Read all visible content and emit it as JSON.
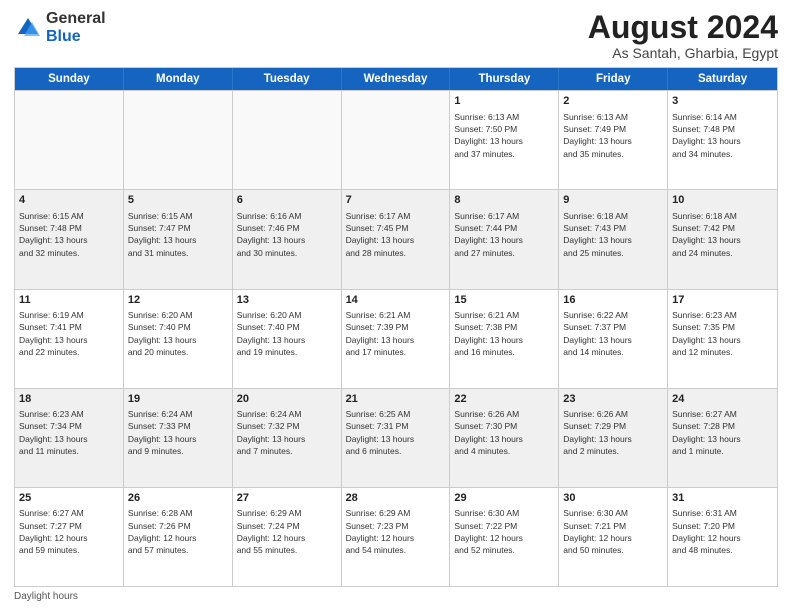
{
  "header": {
    "logo_line1": "General",
    "logo_line2": "Blue",
    "title": "August 2024",
    "subtitle": "As Santah, Gharbia, Egypt"
  },
  "calendar": {
    "weekdays": [
      "Sunday",
      "Monday",
      "Tuesday",
      "Wednesday",
      "Thursday",
      "Friday",
      "Saturday"
    ],
    "weeks": [
      [
        {
          "day": "",
          "info": "",
          "empty": true
        },
        {
          "day": "",
          "info": "",
          "empty": true
        },
        {
          "day": "",
          "info": "",
          "empty": true
        },
        {
          "day": "",
          "info": "",
          "empty": true
        },
        {
          "day": "1",
          "info": "Sunrise: 6:13 AM\nSunset: 7:50 PM\nDaylight: 13 hours\nand 37 minutes.",
          "empty": false
        },
        {
          "day": "2",
          "info": "Sunrise: 6:13 AM\nSunset: 7:49 PM\nDaylight: 13 hours\nand 35 minutes.",
          "empty": false
        },
        {
          "day": "3",
          "info": "Sunrise: 6:14 AM\nSunset: 7:48 PM\nDaylight: 13 hours\nand 34 minutes.",
          "empty": false
        }
      ],
      [
        {
          "day": "4",
          "info": "Sunrise: 6:15 AM\nSunset: 7:48 PM\nDaylight: 13 hours\nand 32 minutes.",
          "empty": false
        },
        {
          "day": "5",
          "info": "Sunrise: 6:15 AM\nSunset: 7:47 PM\nDaylight: 13 hours\nand 31 minutes.",
          "empty": false
        },
        {
          "day": "6",
          "info": "Sunrise: 6:16 AM\nSunset: 7:46 PM\nDaylight: 13 hours\nand 30 minutes.",
          "empty": false
        },
        {
          "day": "7",
          "info": "Sunrise: 6:17 AM\nSunset: 7:45 PM\nDaylight: 13 hours\nand 28 minutes.",
          "empty": false
        },
        {
          "day": "8",
          "info": "Sunrise: 6:17 AM\nSunset: 7:44 PM\nDaylight: 13 hours\nand 27 minutes.",
          "empty": false
        },
        {
          "day": "9",
          "info": "Sunrise: 6:18 AM\nSunset: 7:43 PM\nDaylight: 13 hours\nand 25 minutes.",
          "empty": false
        },
        {
          "day": "10",
          "info": "Sunrise: 6:18 AM\nSunset: 7:42 PM\nDaylight: 13 hours\nand 24 minutes.",
          "empty": false
        }
      ],
      [
        {
          "day": "11",
          "info": "Sunrise: 6:19 AM\nSunset: 7:41 PM\nDaylight: 13 hours\nand 22 minutes.",
          "empty": false
        },
        {
          "day": "12",
          "info": "Sunrise: 6:20 AM\nSunset: 7:40 PM\nDaylight: 13 hours\nand 20 minutes.",
          "empty": false
        },
        {
          "day": "13",
          "info": "Sunrise: 6:20 AM\nSunset: 7:40 PM\nDaylight: 13 hours\nand 19 minutes.",
          "empty": false
        },
        {
          "day": "14",
          "info": "Sunrise: 6:21 AM\nSunset: 7:39 PM\nDaylight: 13 hours\nand 17 minutes.",
          "empty": false
        },
        {
          "day": "15",
          "info": "Sunrise: 6:21 AM\nSunset: 7:38 PM\nDaylight: 13 hours\nand 16 minutes.",
          "empty": false
        },
        {
          "day": "16",
          "info": "Sunrise: 6:22 AM\nSunset: 7:37 PM\nDaylight: 13 hours\nand 14 minutes.",
          "empty": false
        },
        {
          "day": "17",
          "info": "Sunrise: 6:23 AM\nSunset: 7:35 PM\nDaylight: 13 hours\nand 12 minutes.",
          "empty": false
        }
      ],
      [
        {
          "day": "18",
          "info": "Sunrise: 6:23 AM\nSunset: 7:34 PM\nDaylight: 13 hours\nand 11 minutes.",
          "empty": false
        },
        {
          "day": "19",
          "info": "Sunrise: 6:24 AM\nSunset: 7:33 PM\nDaylight: 13 hours\nand 9 minutes.",
          "empty": false
        },
        {
          "day": "20",
          "info": "Sunrise: 6:24 AM\nSunset: 7:32 PM\nDaylight: 13 hours\nand 7 minutes.",
          "empty": false
        },
        {
          "day": "21",
          "info": "Sunrise: 6:25 AM\nSunset: 7:31 PM\nDaylight: 13 hours\nand 6 minutes.",
          "empty": false
        },
        {
          "day": "22",
          "info": "Sunrise: 6:26 AM\nSunset: 7:30 PM\nDaylight: 13 hours\nand 4 minutes.",
          "empty": false
        },
        {
          "day": "23",
          "info": "Sunrise: 6:26 AM\nSunset: 7:29 PM\nDaylight: 13 hours\nand 2 minutes.",
          "empty": false
        },
        {
          "day": "24",
          "info": "Sunrise: 6:27 AM\nSunset: 7:28 PM\nDaylight: 13 hours\nand 1 minute.",
          "empty": false
        }
      ],
      [
        {
          "day": "25",
          "info": "Sunrise: 6:27 AM\nSunset: 7:27 PM\nDaylight: 12 hours\nand 59 minutes.",
          "empty": false
        },
        {
          "day": "26",
          "info": "Sunrise: 6:28 AM\nSunset: 7:26 PM\nDaylight: 12 hours\nand 57 minutes.",
          "empty": false
        },
        {
          "day": "27",
          "info": "Sunrise: 6:29 AM\nSunset: 7:24 PM\nDaylight: 12 hours\nand 55 minutes.",
          "empty": false
        },
        {
          "day": "28",
          "info": "Sunrise: 6:29 AM\nSunset: 7:23 PM\nDaylight: 12 hours\nand 54 minutes.",
          "empty": false
        },
        {
          "day": "29",
          "info": "Sunrise: 6:30 AM\nSunset: 7:22 PM\nDaylight: 12 hours\nand 52 minutes.",
          "empty": false
        },
        {
          "day": "30",
          "info": "Sunrise: 6:30 AM\nSunset: 7:21 PM\nDaylight: 12 hours\nand 50 minutes.",
          "empty": false
        },
        {
          "day": "31",
          "info": "Sunrise: 6:31 AM\nSunset: 7:20 PM\nDaylight: 12 hours\nand 48 minutes.",
          "empty": false
        }
      ]
    ]
  },
  "footer": {
    "note": "Daylight hours"
  },
  "colors": {
    "header_bg": "#1565C0",
    "shaded_row": "#f0f0f0"
  }
}
